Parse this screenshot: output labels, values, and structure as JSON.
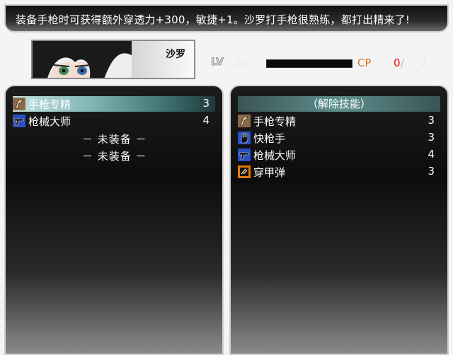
{
  "help": {
    "text": "装备手枪时可获得额外穿透力+300，敏捷+1。沙罗打手枪很熟练，都打出精来了!"
  },
  "character": {
    "name": "沙罗",
    "level_label": "LV",
    "level": "20",
    "cp_label": "CP",
    "cp_current": "0",
    "cp_separator": "/",
    "cp_max": "7"
  },
  "equipped": {
    "items": [
      {
        "label": "手枪专精",
        "level": "3",
        "icon": "pistol-mastery-icon",
        "selected": true
      },
      {
        "label": "枪械大师",
        "level": "4",
        "icon": "gun-master-icon",
        "selected": false
      }
    ],
    "empty_slots": [
      "－ 未装备 －",
      "－ 未装备 －"
    ]
  },
  "available": {
    "header": "（解除技能）",
    "items": [
      {
        "label": "手枪专精",
        "level": "3",
        "icon": "pistol-mastery-icon"
      },
      {
        "label": "快枪手",
        "level": "3",
        "icon": "quickdraw-hand-icon"
      },
      {
        "label": "枪械大师",
        "level": "4",
        "icon": "gun-master-icon"
      },
      {
        "label": "穿甲弹",
        "level": "3",
        "icon": "armor-piercing-icon"
      }
    ]
  },
  "colors": {
    "selection": "#7eb4b4",
    "cp_label": "#c77a38",
    "cp_current": "#d11515",
    "icon_brown": "#8a6a4a",
    "icon_blue": "#2a4fbf",
    "icon_orange": "#e07a10"
  }
}
